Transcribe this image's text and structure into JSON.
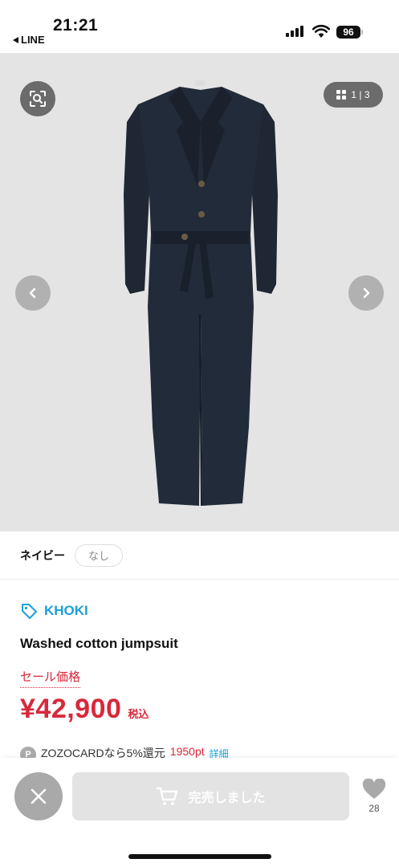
{
  "status_bar": {
    "time": "21:21",
    "back_app": "LINE",
    "battery": "96"
  },
  "gallery": {
    "page_indicator": "1 | 3",
    "icons": [
      "image-search-icon",
      "grid-icon",
      "chevron-left-icon",
      "chevron-right-icon"
    ]
  },
  "variant": {
    "color_name": "ネイビー",
    "stock": "なし"
  },
  "product": {
    "brand": "KHOKI",
    "name": "Washed cotton jumpsuit",
    "sale_label": "セール価格",
    "price": "¥42,900",
    "tax_label": "税込",
    "card_badge": "P",
    "card_text": "ZOZOCARDなら5%還元",
    "card_points": "1950pt",
    "card_detail": "詳細"
  },
  "bottom_bar": {
    "soldout_label": "完売しました",
    "favorite_count": "28"
  },
  "colors": {
    "accent_blue": "#1aa0d8",
    "sale_red": "#d8283b",
    "button_gray": "#e3e3e3"
  }
}
